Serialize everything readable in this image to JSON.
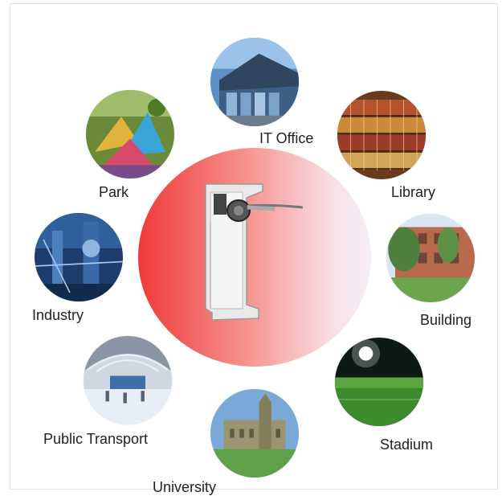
{
  "scenarios": [
    {
      "label": "IT Office"
    },
    {
      "label": "Library"
    },
    {
      "label": "Building"
    },
    {
      "label": "Stadium"
    },
    {
      "label": "University"
    },
    {
      "label": "Public Transport"
    },
    {
      "label": "Industry"
    },
    {
      "label": "Park"
    }
  ],
  "colors": {
    "center_gradient_start": "#ee3a3a",
    "center_gradient_end": "#f6eef6",
    "label_text": "#222222"
  }
}
